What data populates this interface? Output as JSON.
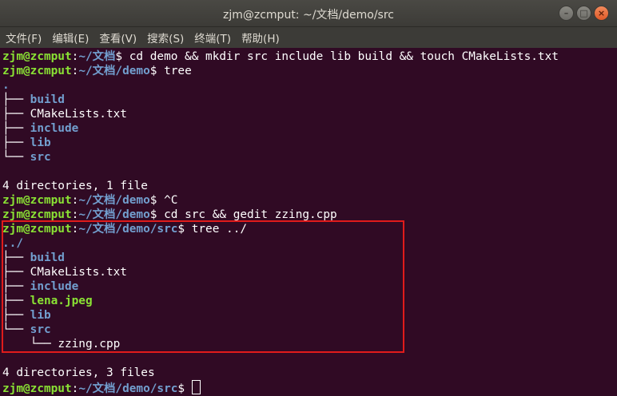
{
  "window": {
    "title": "zjm@zcmput: ~/文档/demo/src",
    "buttons": [
      "–",
      "□",
      "×"
    ]
  },
  "menu": [
    "文件(F)",
    "编辑(E)",
    "查看(V)",
    "搜索(S)",
    "终端(T)",
    "帮助(H)"
  ],
  "prompt": {
    "user": "zjm@zcmput",
    "sep": ":",
    "home": "~/文档",
    "demo": "/demo",
    "src": "/src",
    "dollar": "$ "
  },
  "commands": {
    "c1": "cd demo && mkdir src include lib build && touch CMakeLists.txt",
    "c2": "tree",
    "c3": "^C",
    "c4": "cd src && gedit zzing.cpp",
    "c5": "tree ../"
  },
  "tree1": {
    "root": ".",
    "branch": "├── ",
    "last": "└── ",
    "items": [
      "build",
      "CMakeLists.txt",
      "include",
      "lib",
      "src"
    ],
    "summary": "4 directories, 1 file"
  },
  "tree2": {
    "root": "../",
    "items": [
      "build",
      "CMakeLists.txt",
      "include",
      "lena.jpeg",
      "lib",
      "src"
    ],
    "sub_prefix": "    └── ",
    "sub_item": "zzing.cpp",
    "summary": "4 directories, 3 files"
  },
  "colors": {
    "background": "#300a24",
    "user": "#8ae234",
    "path": "#729fcf",
    "highlight": "#e01b1b"
  }
}
